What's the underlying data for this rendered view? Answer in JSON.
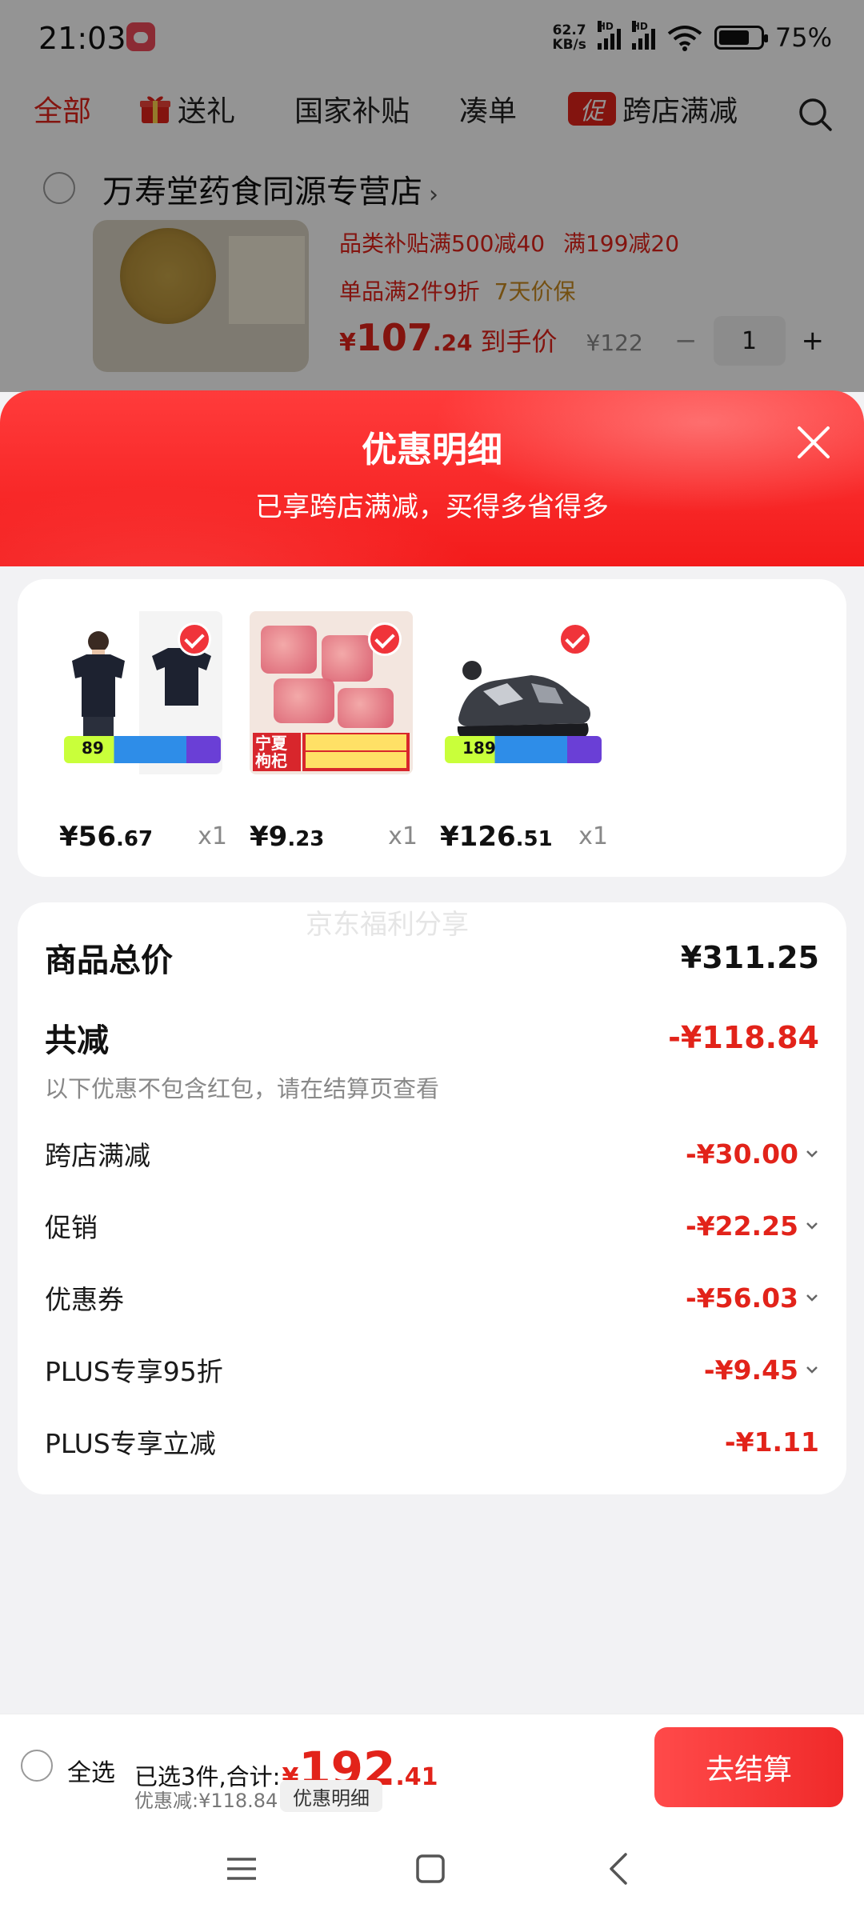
{
  "status_bar": {
    "time": "21:03",
    "net_speed_value": "62.7",
    "net_speed_unit": "KB/s",
    "network_label": "HD",
    "battery_text": "75%"
  },
  "top_tabs": [
    {
      "label": "全部"
    },
    {
      "label": "送礼"
    },
    {
      "label": "国家补贴"
    },
    {
      "label": "凑单"
    },
    {
      "label": "跨店满减",
      "badge": "促"
    }
  ],
  "store": {
    "name": "万寿堂药食同源专营店",
    "promos": [
      "品类补贴满500减40",
      "满199减20"
    ],
    "promo_line2": "单品满2件9折",
    "promo_line2_extra": "7天价保",
    "price_sym": "¥",
    "price_int": "107",
    "price_dec": ".24",
    "price_tag": "到手价",
    "original_price": "¥122",
    "quantity": "1",
    "minus": "−",
    "plus": "+"
  },
  "sheet": {
    "title": "优惠明细",
    "subtitle": "已享跨店满减，买得多省得多"
  },
  "products": [
    {
      "price_int": "¥56",
      "price_dec": ".67",
      "qty": "x1",
      "tag_price": "89",
      "image_kind": "tshirt"
    },
    {
      "price_int": "¥9",
      "price_dec": ".23",
      "qty": "x1",
      "label": "宁夏枸杞",
      "image_kind": "goji"
    },
    {
      "price_int": "¥126",
      "price_dec": ".51",
      "qty": "x1",
      "tag_price": "189",
      "image_kind": "shoe"
    }
  ],
  "summary": {
    "watermark": "京东福利分享",
    "total_label": "商品总价",
    "total_value": "¥311.25",
    "reduce_label": "共减",
    "reduce_value": "-¥118.84",
    "note": "以下优惠不包含红包，请在结算页查看",
    "lines": [
      {
        "label": "跨店满减",
        "value": "-¥30.00",
        "expandable": true
      },
      {
        "label": "促销",
        "value": "-¥22.25",
        "expandable": true
      },
      {
        "label": "优惠券",
        "value": "-¥56.03",
        "expandable": true
      },
      {
        "label": "PLUS专享95折",
        "value": "-¥9.45",
        "expandable": true
      },
      {
        "label": "PLUS专享立减",
        "value": "-¥1.11",
        "expandable": false
      }
    ]
  },
  "bottom_bar": {
    "select_all": "全选",
    "selected_text": "已选3件,合计:",
    "total_sym": "¥",
    "total_int": "192",
    "total_dec": ".41",
    "discount_text": "优惠减:¥118.84",
    "discount_detail": "优惠明细",
    "checkout": "去结算"
  },
  "colors": {
    "brand_red": "#e2231a",
    "header_red": "#f31b1b",
    "page_bg": "#f2f2f4"
  },
  "icons": [
    "gift-icon",
    "search-icon",
    "close-icon",
    "check-icon",
    "chevron-down-icon",
    "menu-icon",
    "home-icon",
    "back-icon",
    "wifi-icon",
    "battery-icon"
  ]
}
